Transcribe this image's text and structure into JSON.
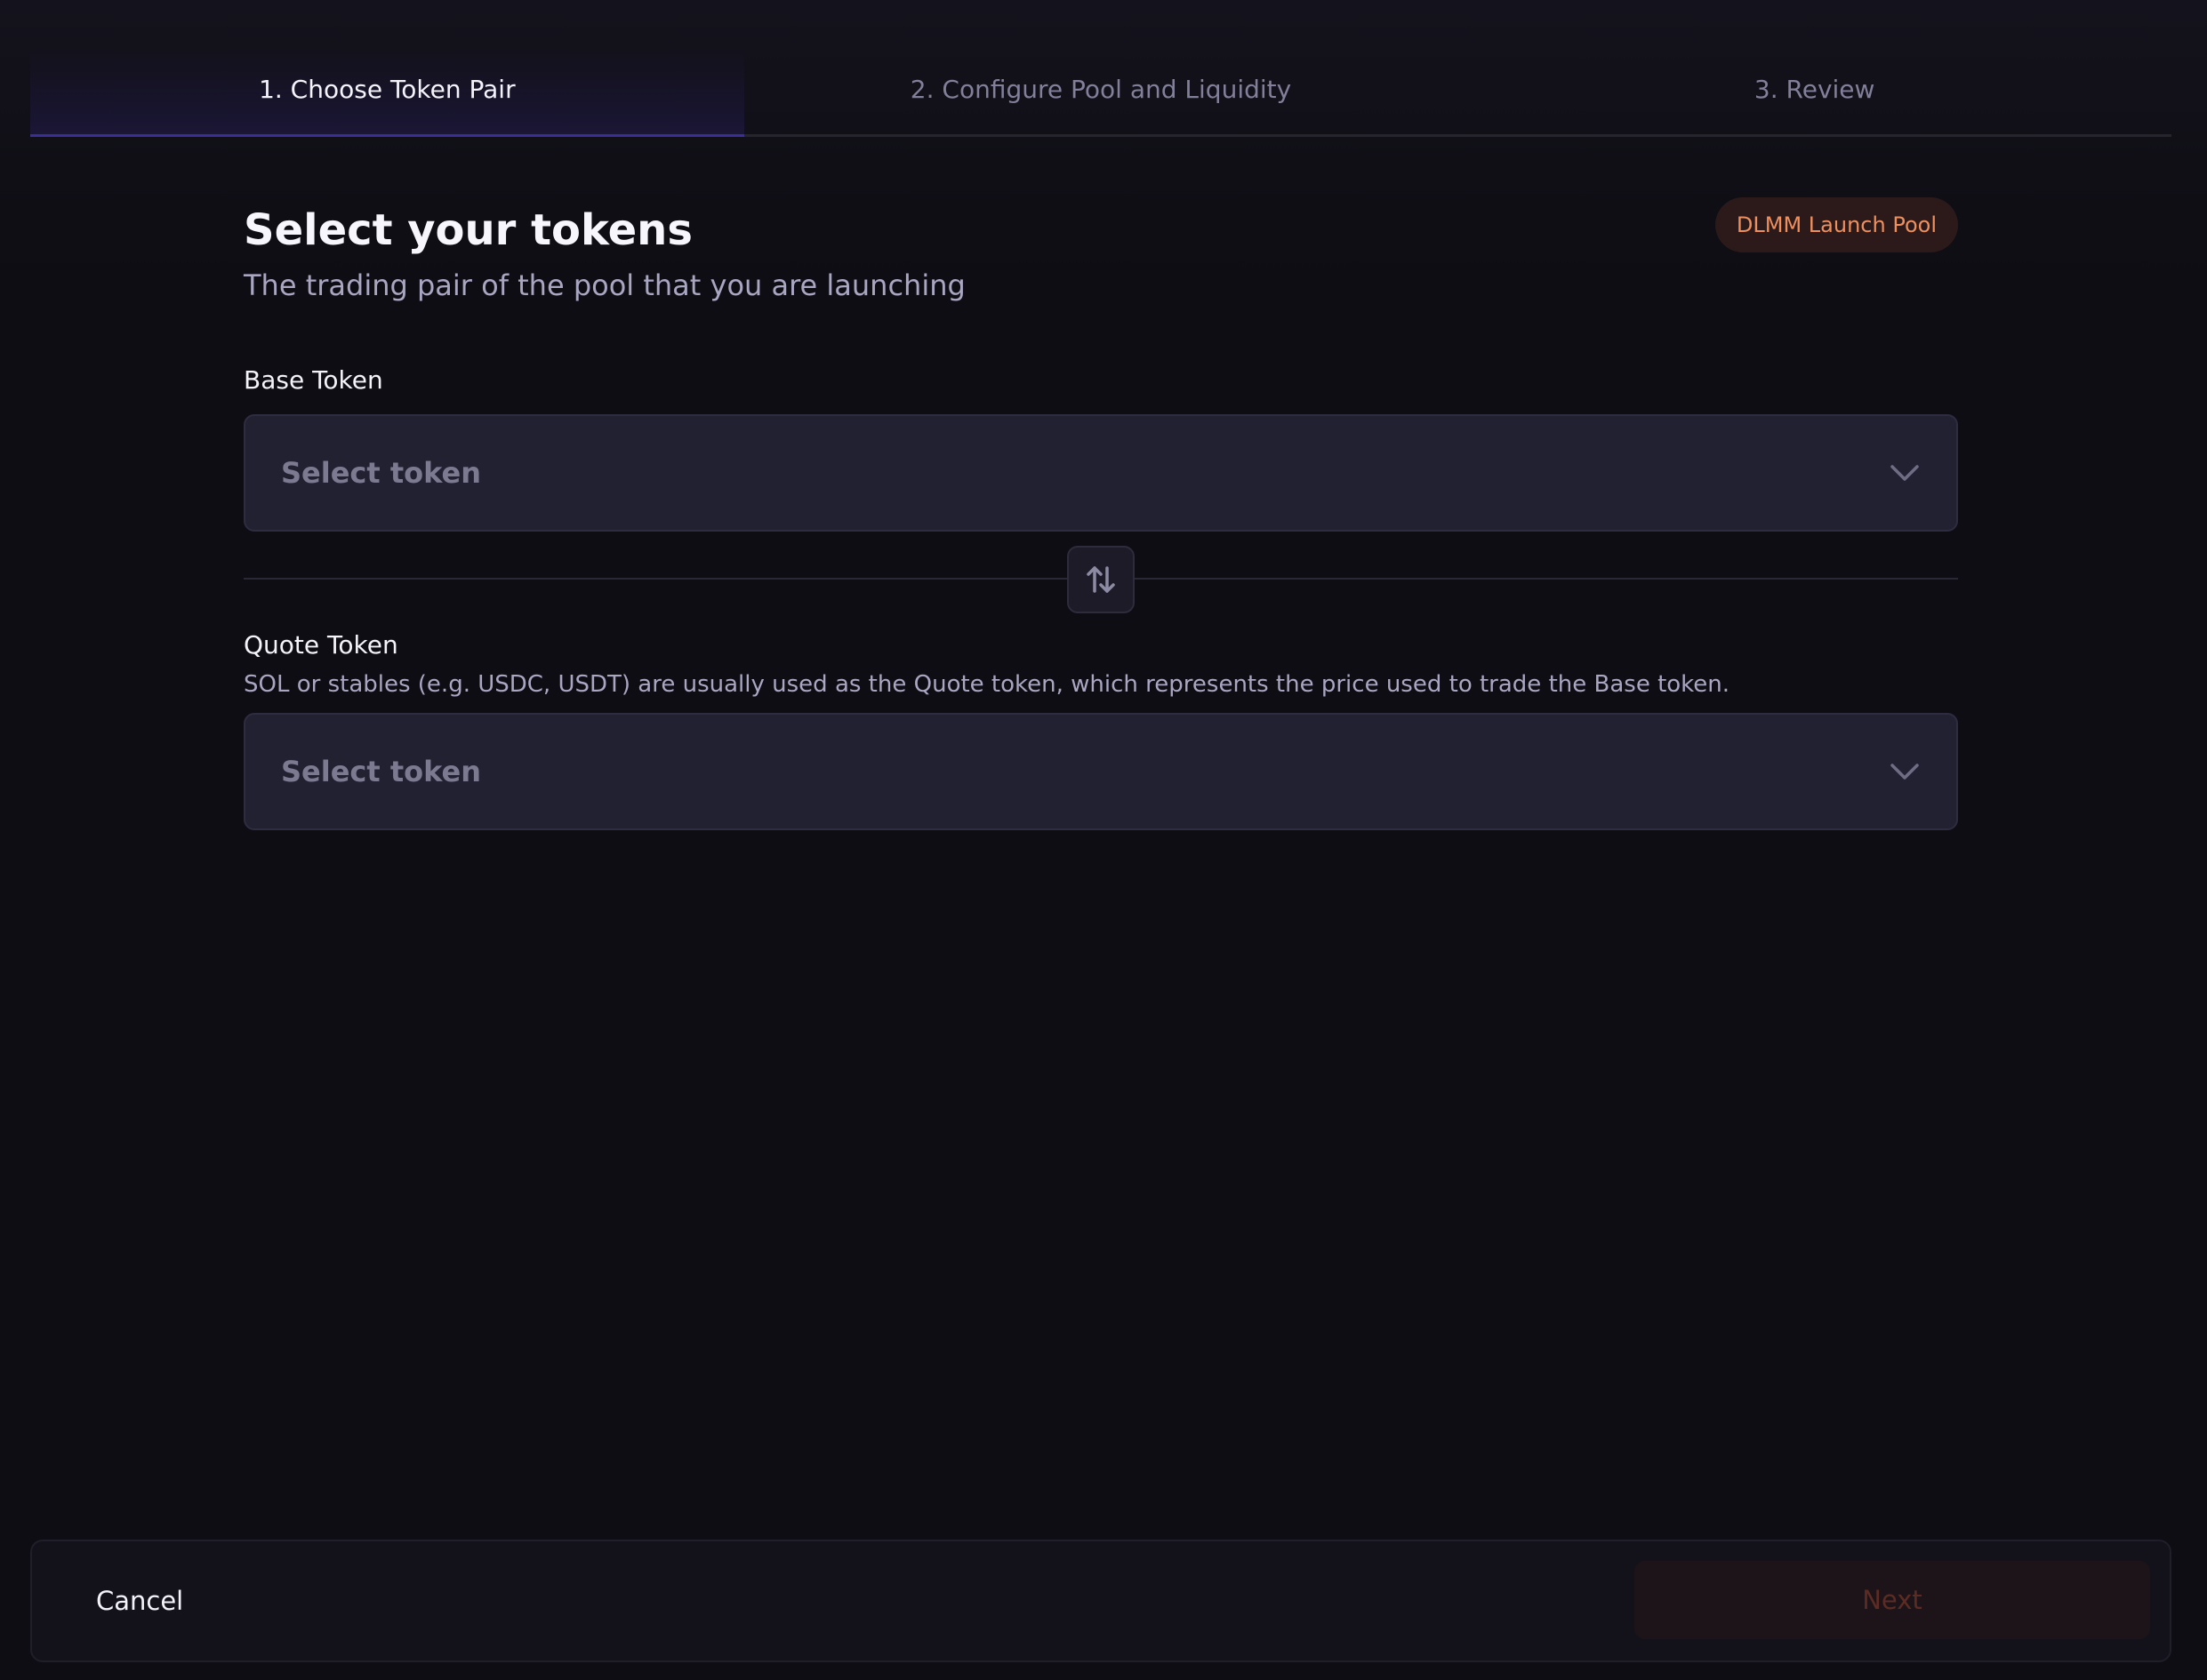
{
  "stepper": {
    "steps": [
      {
        "label": "1. Choose Token Pair",
        "active": true
      },
      {
        "label": "2. Configure Pool and Liquidity",
        "active": false
      },
      {
        "label": "3. Review",
        "active": false
      }
    ]
  },
  "header": {
    "title": "Select your tokens",
    "subtitle": "The trading pair of the pool that you are launching",
    "badge": "DLMM Launch Pool"
  },
  "base_token": {
    "label": "Base Token",
    "placeholder": "Select token"
  },
  "quote_token": {
    "label": "Quote Token",
    "helper": "SOL or stables (e.g. USDC, USDT) are usually used as the Quote token, which represents the price used to trade the Base token.",
    "placeholder": "Select token"
  },
  "footer": {
    "cancel_label": "Cancel",
    "next_label": "Next"
  },
  "colors": {
    "background": "#0e0d13",
    "accent_badge": "#ee8f5e",
    "active_step_underline": "#3a2f9a"
  },
  "icons": {
    "chevron": "chevron-down-icon",
    "swap": "swap-vertical-icon"
  }
}
